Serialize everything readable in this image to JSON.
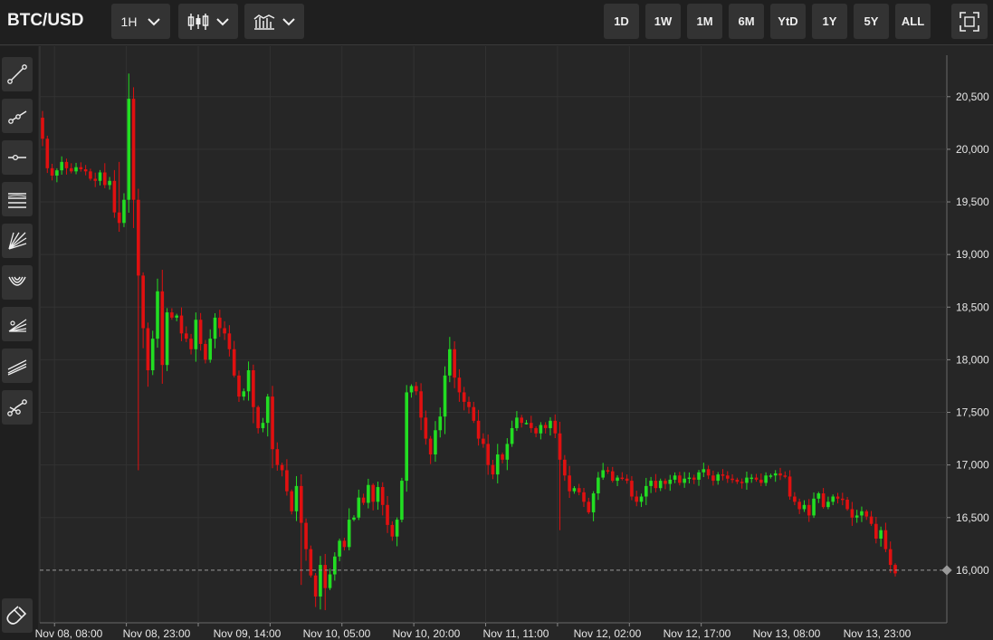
{
  "header": {
    "symbol": "BTC/USD",
    "interval": "1H",
    "chart_style_icon": "candlestick-icon",
    "indicators_icon": "indicators-icon",
    "fullscreen_icon": "fullscreen-icon"
  },
  "ranges": [
    "1D",
    "1W",
    "1M",
    "6M",
    "YtD",
    "1Y",
    "5Y",
    "ALL"
  ],
  "tools": [
    "trend-line-icon",
    "ray-icon",
    "horizontal-ray-icon",
    "parallel-channel-icon",
    "fan-icon",
    "arc-icon",
    "pitchfork-icon",
    "regression-channel-icon",
    "polyline-icon",
    "magnet-icon"
  ],
  "colors": {
    "up": "#22dd22",
    "down": "#e01010",
    "background": "#262626",
    "grid": "#333333"
  },
  "chart_data": {
    "type": "candlestick",
    "interval": "1H",
    "y_ticks": [
      "20,500",
      "20,000",
      "19,500",
      "19,000",
      "18,500",
      "18,000",
      "17,500",
      "17,000",
      "16,500",
      "16,000"
    ],
    "x_ticks": [
      "Nov 08, 08:00",
      "Nov 08, 23:00",
      "Nov 09, 14:00",
      "Nov 10, 05:00",
      "Nov 10, 20:00",
      "Nov 11, 11:00",
      "Nov 12, 02:00",
      "Nov 12, 17:00",
      "Nov 13, 08:00",
      "Nov 13, 23:00"
    ],
    "ylim": [
      15500,
      20980
    ],
    "last_price": 16000,
    "grid": true,
    "closes": [
      20100,
      19820,
      19750,
      19800,
      19880,
      19820,
      19790,
      19830,
      19810,
      19790,
      19720,
      19700,
      19780,
      19660,
      19700,
      19400,
      19300,
      19520,
      20480,
      19520,
      18800,
      18300,
      17900,
      18200,
      18650,
      17950,
      18450,
      18400,
      18420,
      18250,
      18200,
      18100,
      18380,
      18150,
      18000,
      18200,
      18400,
      18300,
      18250,
      18100,
      17850,
      17650,
      17700,
      17900,
      17550,
      17350,
      17400,
      17650,
      17150,
      17000,
      16950,
      16750,
      16560,
      16800,
      16450,
      16200,
      15950,
      15750,
      16050,
      15830,
      15960,
      16130,
      16280,
      16220,
      16480,
      16500,
      16690,
      16640,
      16810,
      16650,
      16790,
      16620,
      16430,
      16320,
      16480,
      16850,
      17690,
      17750,
      17700,
      17450,
      17250,
      17100,
      17330,
      17460,
      17850,
      18100,
      17830,
      17690,
      17600,
      17550,
      17420,
      17250,
      17200,
      17000,
      16910,
      17100,
      17050,
      17200,
      17350,
      17450,
      17400,
      17400,
      17350,
      17300,
      17380,
      17350,
      17420,
      17300,
      17050,
      16900,
      16750,
      16780,
      16740,
      16650,
      16550,
      16730,
      16880,
      16950,
      16940,
      16850,
      16880,
      16870,
      16850,
      16700,
      16650,
      16700,
      16800,
      16850,
      16780,
      16850,
      16820,
      16860,
      16900,
      16830,
      16870,
      16880,
      16860,
      16930,
      16960,
      16900,
      16850,
      16910,
      16900,
      16870,
      16860,
      16840,
      16830,
      16880,
      16880,
      16860,
      16830,
      16900,
      16900,
      16920,
      16900,
      16890,
      16700,
      16650,
      16580,
      16620,
      16520,
      16680,
      16730,
      16600,
      16650,
      16700,
      16680,
      16670,
      16580,
      16500,
      16520,
      16560,
      16510,
      16440,
      16300,
      16380,
      16200,
      16050,
      15970
    ]
  }
}
